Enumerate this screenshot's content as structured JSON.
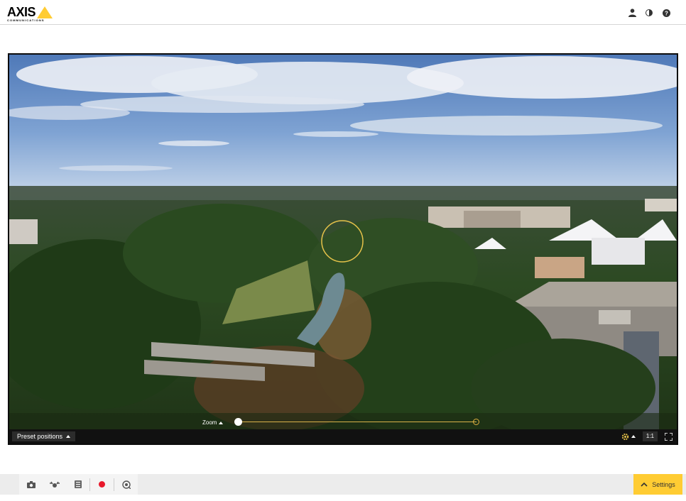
{
  "header": {
    "logo_text": "AXIS",
    "logo_subtext": "COMMUNICATIONS",
    "icons": [
      "user-icon",
      "contrast-icon",
      "help-icon"
    ]
  },
  "video": {
    "preset_label": "Preset positions",
    "zoom_label": "Zoom",
    "ratio_label": "1:1",
    "icons": [
      "gear-icon",
      "fullscreen-icon"
    ]
  },
  "toolbar": {
    "buttons": [
      "snapshot-icon",
      "ptz-icon",
      "stream-profile-icon",
      "record-icon",
      "focus-icon"
    ],
    "settings_label": "Settings"
  },
  "colors": {
    "accent": "#ffcc33",
    "record": "#e8192c"
  }
}
